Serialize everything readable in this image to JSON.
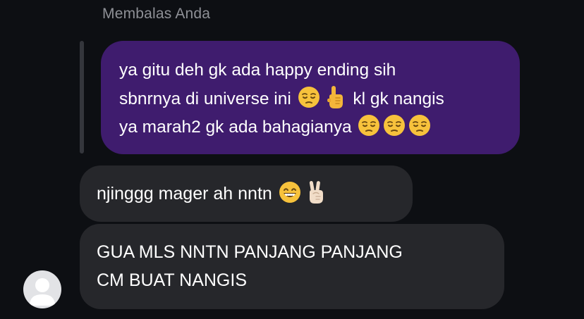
{
  "reply_header": {
    "label": "Membalas Anda"
  },
  "quoted_message": {
    "line1": "ya gitu deh gk ada happy ending sih",
    "line2_a": "sbnrnya di universe ini",
    "line2_b": "kl gk nangis",
    "line3": "ya marah2 gk ada bahagianya",
    "emojis": [
      "pensive-face",
      "pointing-up-hand",
      "pensive-face",
      "pensive-face",
      "pensive-face"
    ]
  },
  "messages": [
    {
      "text": "njinggg mager ah nntn",
      "emojis": [
        "grinning-face",
        "victory-hand"
      ]
    },
    {
      "line1": "GUA MLS NNTN PANJANG PANJANG",
      "line2": "CM BUAT NANGIS"
    }
  ],
  "avatar": {
    "icon": "default-user-avatar"
  },
  "colors": {
    "background": "#0d0f13",
    "outgoing_bubble": "#3f1c6e",
    "incoming_bubble": "#26272b",
    "reply_label": "#8e9096"
  }
}
